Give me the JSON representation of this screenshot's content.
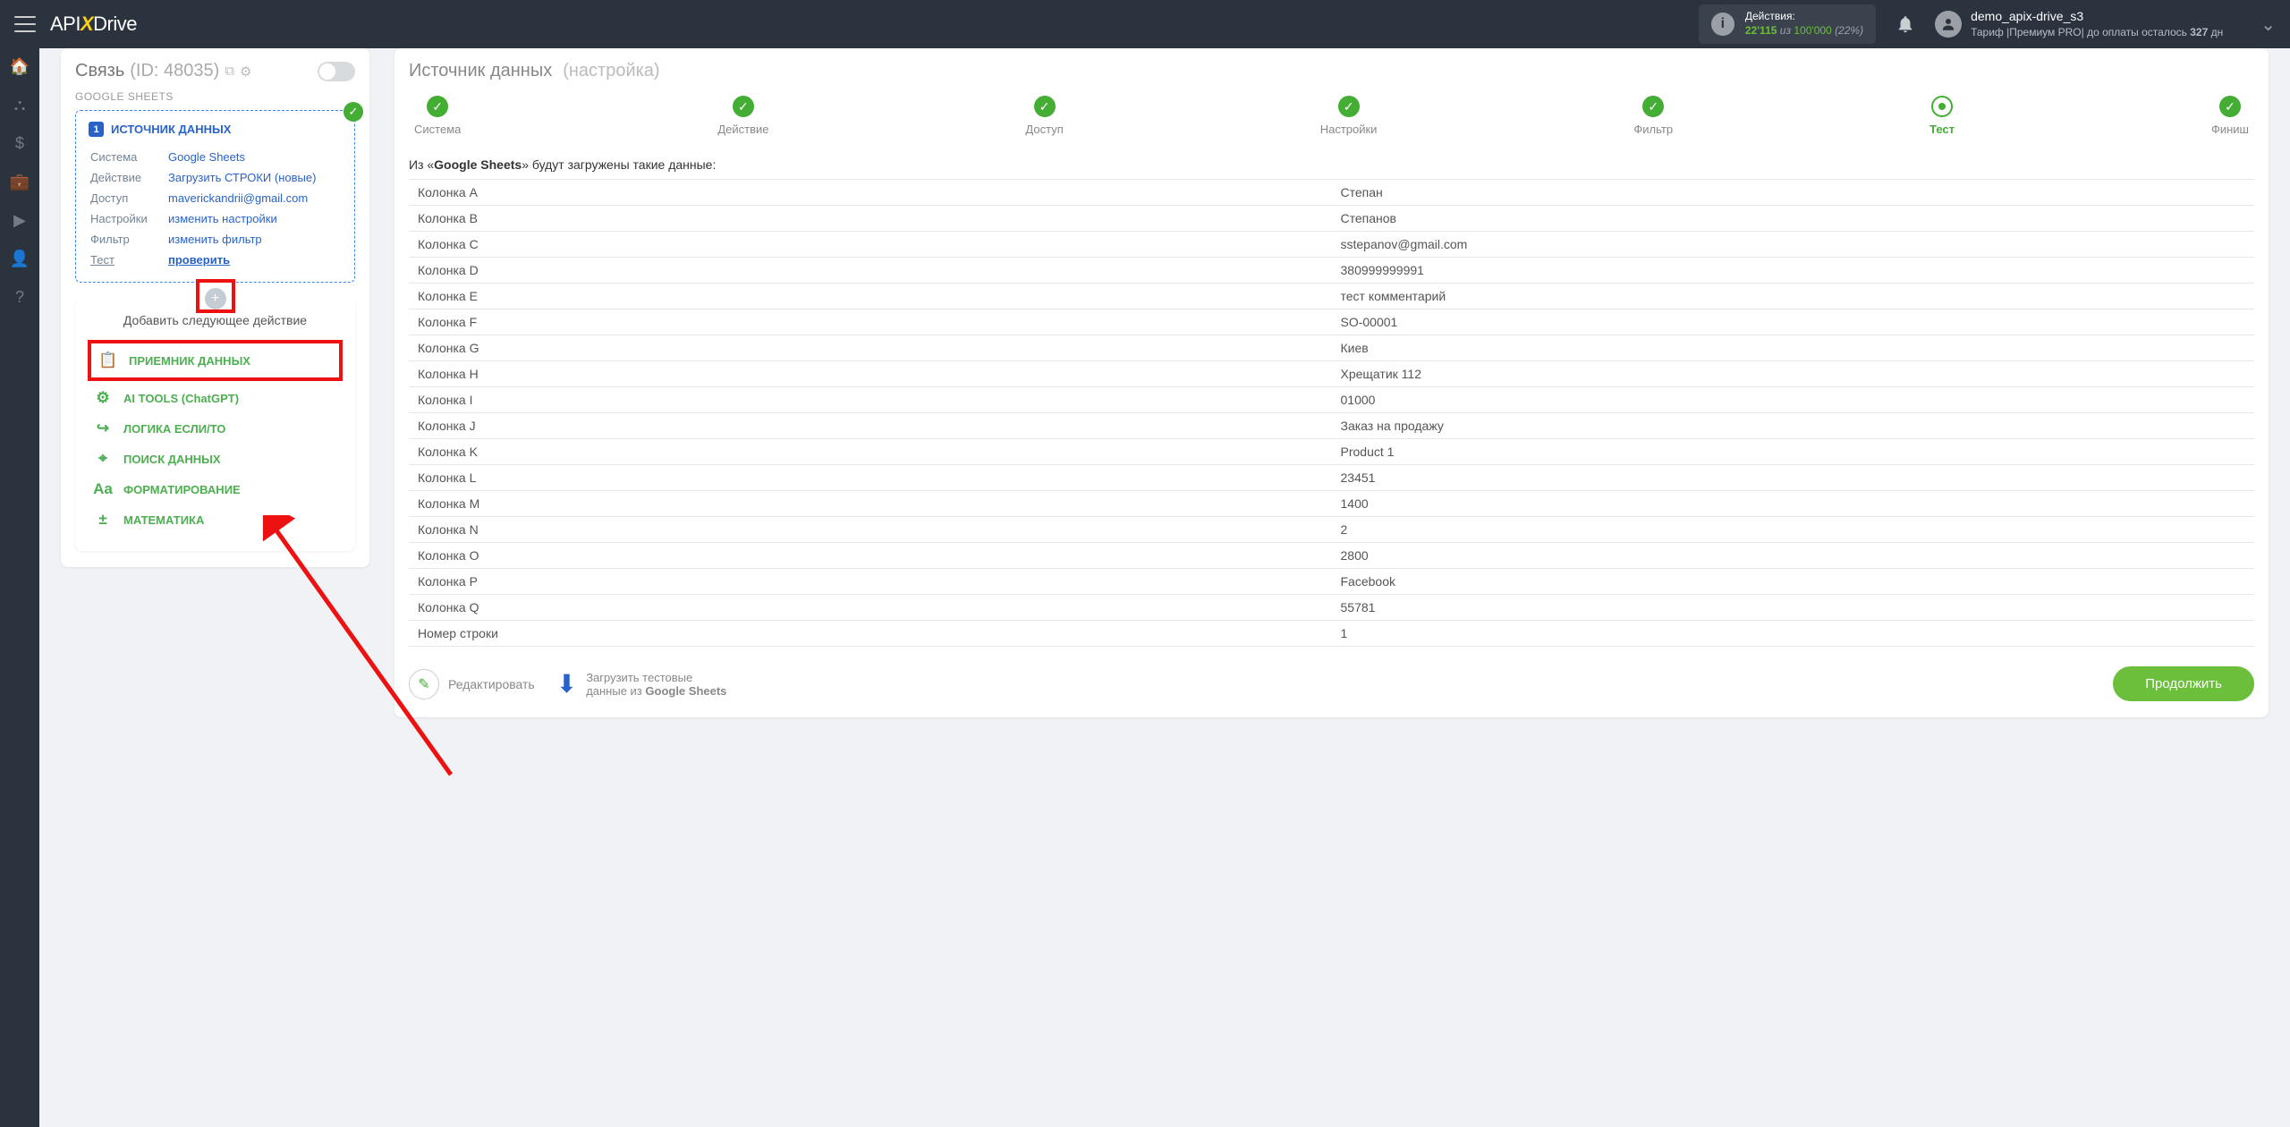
{
  "top": {
    "logo_a": "API",
    "logo_b": "Drive",
    "actions_label": "Действия:",
    "actions_used": "22'115",
    "actions_of_word": "из",
    "actions_total": "100'000",
    "actions_pct": "(22%)",
    "username": "demo_apix-drive_s3",
    "tariff_prefix": "Тариф |Премиум PRO| до оплаты осталось ",
    "tariff_days": "327",
    "tariff_suffix": " дн"
  },
  "conn": {
    "title": "Связь",
    "id_label": "(ID: 48035)",
    "sheets_label": "GOOGLE SHEETS",
    "src_heading": "ИСТОЧНИК ДАННЫХ",
    "rows": [
      {
        "k": "Система",
        "v": "Google Sheets",
        "cls": ""
      },
      {
        "k": "Действие",
        "v": "Загрузить СТРОКИ (новые)",
        "cls": ""
      },
      {
        "k": "Доступ",
        "v": "maverickandrii@gmail.com",
        "cls": ""
      },
      {
        "k": "Настройки",
        "v": "изменить настройки",
        "cls": ""
      },
      {
        "k": "Фильтр",
        "v": "изменить фильтр",
        "cls": ""
      }
    ],
    "test_k": "Тест",
    "test_v": "проверить"
  },
  "add": {
    "title": "Добавить следующее действие",
    "items": [
      {
        "icon": "📋",
        "label": "ПРИЕМНИК ДАННЫХ",
        "hl": true
      },
      {
        "icon": "⚙",
        "label": "AI TOOLS (ChatGPT)",
        "hl": false
      },
      {
        "icon": "↪",
        "label": "ЛОГИКА ЕСЛИ/ТО",
        "hl": false
      },
      {
        "icon": "⌖",
        "label": "ПОИСК ДАННЫХ",
        "hl": false
      },
      {
        "icon": "Aa",
        "label": "ФОРМАТИРОВАНИЕ",
        "hl": false
      },
      {
        "icon": "±",
        "label": "МАТЕМАТИКА",
        "hl": false
      }
    ]
  },
  "right": {
    "title_main": "Источник данных",
    "title_sub": "(настройка)",
    "steps": [
      {
        "label": "Система",
        "state": "done"
      },
      {
        "label": "Действие",
        "state": "done"
      },
      {
        "label": "Доступ",
        "state": "done"
      },
      {
        "label": "Настройки",
        "state": "done"
      },
      {
        "label": "Фильтр",
        "state": "done"
      },
      {
        "label": "Тест",
        "state": "cur"
      },
      {
        "label": "Финиш",
        "state": "fut"
      }
    ],
    "caption_pre": "Из «",
    "caption_src": "Google Sheets",
    "caption_post": "» будут загружены такие данные:",
    "rows": [
      {
        "k": "Колонка A",
        "v": "Степан"
      },
      {
        "k": "Колонка B",
        "v": "Степанов"
      },
      {
        "k": "Колонка C",
        "v": "sstepanov@gmail.com"
      },
      {
        "k": "Колонка D",
        "v": "380999999991"
      },
      {
        "k": "Колонка E",
        "v": "тест комментарий"
      },
      {
        "k": "Колонка F",
        "v": "SO-00001"
      },
      {
        "k": "Колонка G",
        "v": "Киев"
      },
      {
        "k": "Колонка H",
        "v": "Хрещатик 112"
      },
      {
        "k": "Колонка I",
        "v": "01000"
      },
      {
        "k": "Колонка J",
        "v": "Заказ на продажу"
      },
      {
        "k": "Колонка K",
        "v": "Product 1"
      },
      {
        "k": "Колонка L",
        "v": "23451"
      },
      {
        "k": "Колонка M",
        "v": "1400"
      },
      {
        "k": "Колонка N",
        "v": "2"
      },
      {
        "k": "Колонка O",
        "v": "2800"
      },
      {
        "k": "Колонка P",
        "v": "Facebook"
      },
      {
        "k": "Колонка Q",
        "v": "55781"
      },
      {
        "k": "Номер строки",
        "v": "1"
      }
    ],
    "edit_label": "Редактировать",
    "load_line1": "Загрузить тестовые",
    "load_line2_pre": "данные из ",
    "load_line2_b": "Google Sheets",
    "continue": "Продолжить"
  }
}
